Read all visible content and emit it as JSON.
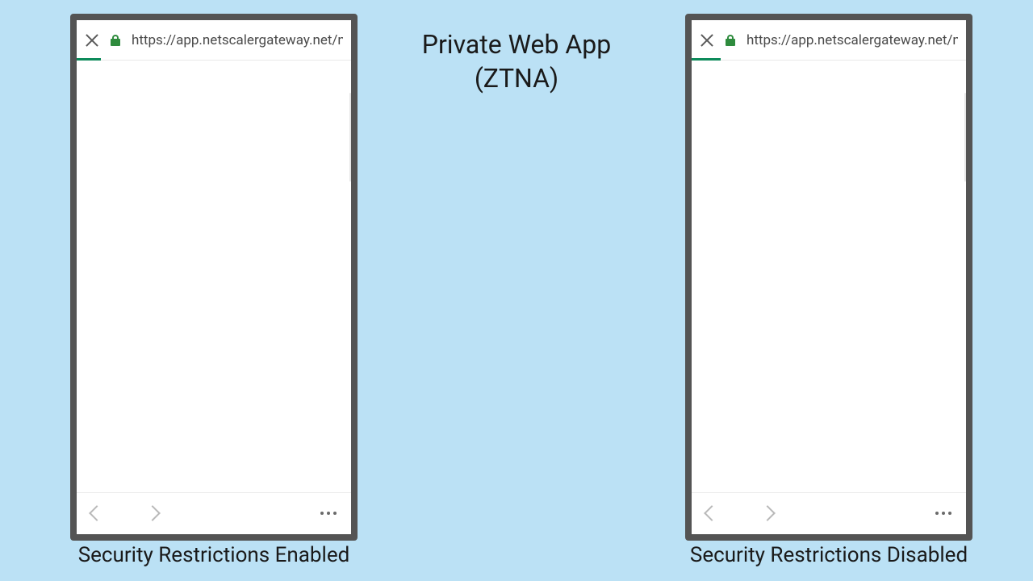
{
  "center": {
    "line1": "Private Web App",
    "line2": "(ZTNA)"
  },
  "left": {
    "url": "https://app.netscalergateway.net/ngs/...",
    "caption": "Security Restrictions Enabled"
  },
  "right": {
    "url": "https://app.netscalergateway.net/ngs/...",
    "caption": "Security Restrictions Disabled"
  }
}
